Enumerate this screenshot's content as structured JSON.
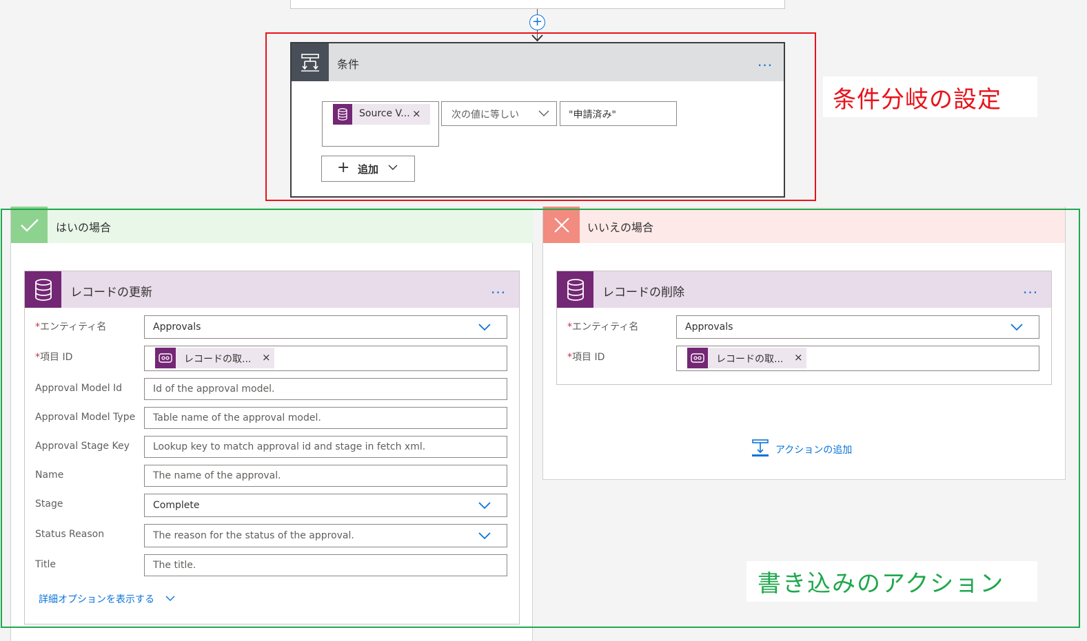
{
  "flow": {
    "insert_step_symbol": "+"
  },
  "condition": {
    "title": "条件",
    "more_symbol": "...",
    "left_token": "Source V...",
    "token_remove": "×",
    "operator": "次の値に等しい",
    "value": "\"申請済み\"",
    "add_label": "追加",
    "add_symbol": "+"
  },
  "annotations": {
    "condition_label": "条件分岐の設定",
    "action_label": "書き込みのアクション",
    "condition_color": "#e8121a",
    "action_color": "#1ea84c"
  },
  "yes_branch": {
    "title": "はいの場合",
    "card": {
      "title": "レコードの更新",
      "more_symbol": "...",
      "fields": [
        {
          "label": "エンティティ名",
          "required": true,
          "value": "Approvals",
          "type": "select"
        },
        {
          "label": "項目 ID",
          "required": true,
          "value": "レコードの取...",
          "type": "token"
        },
        {
          "label": "Approval Model Id",
          "required": false,
          "value": "Id of the approval model.",
          "type": "text"
        },
        {
          "label": "Approval Model Type",
          "required": false,
          "value": "Table name of the approval model.",
          "type": "text"
        },
        {
          "label": "Approval Stage Key",
          "required": false,
          "value": "Lookup key to match approval id and stage in fetch xml.",
          "type": "text"
        },
        {
          "label": "Name",
          "required": false,
          "value": "The name of the approval.",
          "type": "text"
        },
        {
          "label": "Stage",
          "required": false,
          "value": "Complete",
          "type": "select"
        },
        {
          "label": "Status Reason",
          "required": false,
          "value": "The reason for the status of the approval.",
          "type": "select"
        },
        {
          "label": "Title",
          "required": false,
          "value": "The title.",
          "type": "text"
        }
      ],
      "required_mark": "*",
      "token_remove": "×",
      "more_options": "詳細オプションを表示する"
    }
  },
  "no_branch": {
    "title": "いいえの場合",
    "card": {
      "title": "レコードの削除",
      "more_symbol": "...",
      "fields": [
        {
          "label": "エンティティ名",
          "required": true,
          "value": "Approvals",
          "type": "select"
        },
        {
          "label": "項目 ID",
          "required": true,
          "value": "レコードの取...",
          "type": "token"
        }
      ],
      "required_mark": "*",
      "token_remove": "×"
    },
    "add_action": "アクションの追加"
  },
  "colors": {
    "accent_blue": "#0a73d9",
    "dataverse_purple": "#742774",
    "yes_green": "#8ed28f",
    "no_red": "#f28b80"
  }
}
